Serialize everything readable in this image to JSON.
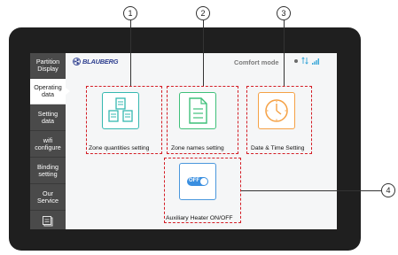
{
  "header": {
    "brand": "BLAUBERG",
    "mode": "Comfort mode"
  },
  "sidebar": {
    "items": [
      {
        "label": "Partition\nDisplay"
      },
      {
        "label": "Operating\ndata"
      },
      {
        "label": "Setting\ndata"
      },
      {
        "label": "wifi\nconfigure"
      },
      {
        "label": "Binding\nsetting"
      },
      {
        "label": "Our\nService"
      }
    ]
  },
  "tiles": [
    {
      "label": "Zone quantities setting"
    },
    {
      "label": "Zone names setting"
    },
    {
      "label": "Date & Time  Setting"
    },
    {
      "label": "Auxiliary Heater ON/OFF",
      "toggle": "OFF"
    }
  ],
  "callouts": [
    "1",
    "2",
    "3",
    "4"
  ],
  "colors": {
    "teal": "#35b8b0",
    "green": "#3fc07a",
    "orange": "#f5a145",
    "blue": "#4a97dd",
    "dash_red": "#d41d25",
    "sidebar": "#4a4a4a",
    "brand": "#2d3e8f"
  }
}
